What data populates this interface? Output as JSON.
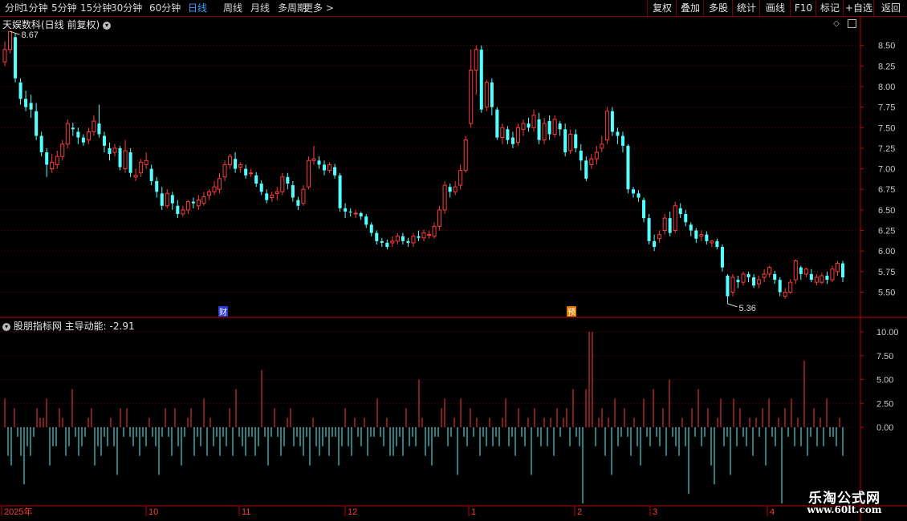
{
  "toolbar": {
    "periods": [
      "分时",
      "1分钟",
      "5分钟",
      "15分钟",
      "30分钟",
      "60分钟",
      "日线",
      "周线",
      "月线",
      "多周期",
      "更多 >"
    ],
    "active_period": "日线",
    "right_buttons": [
      "复权",
      "叠加",
      "多股",
      "统计",
      "画线",
      "F10",
      "标记",
      "+自选",
      "返回"
    ]
  },
  "main_panel": {
    "title": "天娱数科(日线 前复权)",
    "high_label": "8.67",
    "low_label": "5.36",
    "price_ticks": [
      "8.50",
      "8.25",
      "8.00",
      "7.75",
      "7.50",
      "7.25",
      "7.00",
      "6.75",
      "6.50",
      "6.25",
      "6.00",
      "5.75",
      "5.50"
    ],
    "event_badges": [
      {
        "text": "财"
      },
      {
        "text": "预"
      }
    ]
  },
  "indicator_panel": {
    "name": "股朋指标网",
    "line_name": "主导动能:",
    "line_value": "-2.91",
    "ticks": [
      "10.00",
      "7.50",
      "5.00",
      "2.50",
      "0.00"
    ]
  },
  "date_axis": {
    "labels": [
      "2025年",
      "10",
      "11",
      "12",
      "1",
      "2",
      "3",
      "4"
    ]
  },
  "watermark": {
    "title": "乐淘公式网",
    "url": "www.60lt.com"
  },
  "colors": {
    "up": "#ff3b3b",
    "down": "#54ffff",
    "grid": "#7a0000",
    "axis": "#c00000",
    "text": "#c8c8c8"
  },
  "chart_data": {
    "type": "candlestick",
    "title": "天娱数科(日线 前复权)",
    "ylim": [
      5.3,
      8.75
    ],
    "candles": [
      [
        8.3,
        8.45,
        8.25,
        8.55
      ],
      [
        8.45,
        8.67,
        8.4,
        8.67
      ],
      [
        8.6,
        8.1,
        8.05,
        8.65
      ],
      [
        8.05,
        7.85,
        7.78,
        8.1
      ],
      [
        7.85,
        7.75,
        7.7,
        7.95
      ],
      [
        7.8,
        7.72,
        7.62,
        7.9
      ],
      [
        7.7,
        7.4,
        7.35,
        7.8
      ],
      [
        7.4,
        7.2,
        7.15,
        7.45
      ],
      [
        7.2,
        7.05,
        6.9,
        7.25
      ],
      [
        7.0,
        7.08,
        6.95,
        7.18
      ],
      [
        7.05,
        7.15,
        7.0,
        7.22
      ],
      [
        7.15,
        7.3,
        7.1,
        7.35
      ],
      [
        7.3,
        7.55,
        7.25,
        7.6
      ],
      [
        7.5,
        7.48,
        7.4,
        7.56
      ],
      [
        7.45,
        7.38,
        7.3,
        7.5
      ],
      [
        7.38,
        7.32,
        7.28,
        7.42
      ],
      [
        7.35,
        7.45,
        7.3,
        7.5
      ],
      [
        7.45,
        7.58,
        7.4,
        7.65
      ],
      [
        7.55,
        7.42,
        7.38,
        7.78
      ],
      [
        7.4,
        7.28,
        7.2,
        7.45
      ],
      [
        7.25,
        7.18,
        7.1,
        7.32
      ],
      [
        7.2,
        7.25,
        7.15,
        7.3
      ],
      [
        7.25,
        7.02,
        6.98,
        7.28
      ],
      [
        7.0,
        7.22,
        6.95,
        7.35
      ],
      [
        7.2,
        6.95,
        6.9,
        7.25
      ],
      [
        6.9,
        6.92,
        6.85,
        7.0
      ],
      [
        6.95,
        7.08,
        6.9,
        7.12
      ],
      [
        7.05,
        7.1,
        7.0,
        7.2
      ],
      [
        7.0,
        6.85,
        6.8,
        7.05
      ],
      [
        6.85,
        6.72,
        6.65,
        6.9
      ],
      [
        6.7,
        6.55,
        6.5,
        6.78
      ],
      [
        6.55,
        6.7,
        6.52,
        6.75
      ],
      [
        6.68,
        6.58,
        6.5,
        6.72
      ],
      [
        6.55,
        6.45,
        6.4,
        6.62
      ],
      [
        6.45,
        6.5,
        6.42,
        6.55
      ],
      [
        6.5,
        6.6,
        6.45,
        6.62
      ],
      [
        6.6,
        6.58,
        6.52,
        6.65
      ],
      [
        6.55,
        6.62,
        6.5,
        6.68
      ],
      [
        6.58,
        6.66,
        6.55,
        6.72
      ],
      [
        6.68,
        6.72,
        6.62,
        6.75
      ],
      [
        6.72,
        6.78,
        6.68,
        6.85
      ],
      [
        6.75,
        6.88,
        6.7,
        6.95
      ],
      [
        6.9,
        7.05,
        6.85,
        7.1
      ],
      [
        7.05,
        7.15,
        7.0,
        7.18
      ],
      [
        7.12,
        7.0,
        6.95,
        7.2
      ],
      [
        7.02,
        7.05,
        6.95,
        7.08
      ],
      [
        7.0,
        6.92,
        6.88,
        7.05
      ],
      [
        6.95,
        6.95,
        6.9,
        7.0
      ],
      [
        6.92,
        6.82,
        6.78,
        6.96
      ],
      [
        6.82,
        6.72,
        6.68,
        6.86
      ],
      [
        6.7,
        6.62,
        6.58,
        6.75
      ],
      [
        6.65,
        6.68,
        6.6,
        6.72
      ],
      [
        6.7,
        6.72,
        6.62,
        6.78
      ],
      [
        6.72,
        6.9,
        6.68,
        6.95
      ],
      [
        6.9,
        6.82,
        6.75,
        6.95
      ],
      [
        6.8,
        6.65,
        6.6,
        6.85
      ],
      [
        6.62,
        6.55,
        6.5,
        6.66
      ],
      [
        6.58,
        6.75,
        6.55,
        6.8
      ],
      [
        6.78,
        7.1,
        6.75,
        7.15
      ],
      [
        7.1,
        7.12,
        7.05,
        7.28
      ],
      [
        7.1,
        7.05,
        7.0,
        7.15
      ],
      [
        7.05,
        6.98,
        6.92,
        7.1
      ],
      [
        6.98,
        7.05,
        6.95,
        7.08
      ],
      [
        7.02,
        6.92,
        6.88,
        7.06
      ],
      [
        6.92,
        6.52,
        6.48,
        6.95
      ],
      [
        6.52,
        6.48,
        6.4,
        6.58
      ],
      [
        6.48,
        6.47,
        6.42,
        6.52
      ],
      [
        6.46,
        6.46,
        6.4,
        6.5
      ],
      [
        6.46,
        6.42,
        6.38,
        6.48
      ],
      [
        6.42,
        6.32,
        6.28,
        6.45
      ],
      [
        6.32,
        6.22,
        6.18,
        6.35
      ],
      [
        6.22,
        6.12,
        6.08,
        6.25
      ],
      [
        6.12,
        6.1,
        6.05,
        6.16
      ],
      [
        6.1,
        6.05,
        6.02,
        6.14
      ],
      [
        6.1,
        6.12,
        6.05,
        6.18
      ],
      [
        6.12,
        6.18,
        6.08,
        6.22
      ],
      [
        6.18,
        6.12,
        6.08,
        6.22
      ],
      [
        6.12,
        6.1,
        6.05,
        6.16
      ],
      [
        6.1,
        6.18,
        6.05,
        6.22
      ],
      [
        6.18,
        6.16,
        6.12,
        6.25
      ],
      [
        6.16,
        6.22,
        6.12,
        6.26
      ],
      [
        6.2,
        6.2,
        6.15,
        6.25
      ],
      [
        6.18,
        6.3,
        6.15,
        6.35
      ],
      [
        6.3,
        6.5,
        6.25,
        6.55
      ],
      [
        6.5,
        6.8,
        6.45,
        6.85
      ],
      [
        6.78,
        6.72,
        6.65,
        6.82
      ],
      [
        6.72,
        6.78,
        6.68,
        6.85
      ],
      [
        6.8,
        6.98,
        6.75,
        7.05
      ],
      [
        6.98,
        7.35,
        6.95,
        7.4
      ],
      [
        7.55,
        8.2,
        7.5,
        8.45
      ],
      [
        8.2,
        8.45,
        7.9,
        8.5
      ],
      [
        8.45,
        7.72,
        7.68,
        8.5
      ],
      [
        7.75,
        8.05,
        7.7,
        8.08
      ],
      [
        8.05,
        7.75,
        7.65,
        8.1
      ],
      [
        7.72,
        7.38,
        7.35,
        7.75
      ],
      [
        7.38,
        7.5,
        7.3,
        7.55
      ],
      [
        7.48,
        7.35,
        7.3,
        7.52
      ],
      [
        7.38,
        7.3,
        7.25,
        7.45
      ],
      [
        7.32,
        7.5,
        7.28,
        7.55
      ],
      [
        7.48,
        7.55,
        7.4,
        7.6
      ],
      [
        7.55,
        7.5,
        7.45,
        7.62
      ],
      [
        7.5,
        7.65,
        7.45,
        7.72
      ],
      [
        7.6,
        7.35,
        7.3,
        7.68
      ],
      [
        7.35,
        7.55,
        7.3,
        7.62
      ],
      [
        7.58,
        7.42,
        7.35,
        7.65
      ],
      [
        7.42,
        7.6,
        7.38,
        7.65
      ],
      [
        7.55,
        7.48,
        7.4,
        7.58
      ],
      [
        7.48,
        7.2,
        7.15,
        7.55
      ],
      [
        7.22,
        7.42,
        7.18,
        7.48
      ],
      [
        7.42,
        7.25,
        7.2,
        7.48
      ],
      [
        7.22,
        7.1,
        6.98,
        7.3
      ],
      [
        7.1,
        6.88,
        6.85,
        7.15
      ],
      [
        7.05,
        7.12,
        7.0,
        7.18
      ],
      [
        7.12,
        7.2,
        7.05,
        7.28
      ],
      [
        7.25,
        7.3,
        7.2,
        7.4
      ],
      [
        7.35,
        7.7,
        7.3,
        7.75
      ],
      [
        7.7,
        7.45,
        7.4,
        7.75
      ],
      [
        7.45,
        7.4,
        7.3,
        7.5
      ],
      [
        7.4,
        7.28,
        7.2,
        7.45
      ],
      [
        7.28,
        6.75,
        6.7,
        7.3
      ],
      [
        6.75,
        6.7,
        6.65,
        6.78
      ],
      [
        6.7,
        6.65,
        6.6,
        6.74
      ],
      [
        6.62,
        6.4,
        6.35,
        6.65
      ],
      [
        6.4,
        6.12,
        6.08,
        6.45
      ],
      [
        6.12,
        6.05,
        6.0,
        6.2
      ],
      [
        6.15,
        6.2,
        6.1,
        6.25
      ],
      [
        6.25,
        6.4,
        6.2,
        6.45
      ],
      [
        6.4,
        6.22,
        6.18,
        6.48
      ],
      [
        6.25,
        6.55,
        6.22,
        6.6
      ],
      [
        6.52,
        6.45,
        6.4,
        6.58
      ],
      [
        6.45,
        6.35,
        6.3,
        6.5
      ],
      [
        6.32,
        6.25,
        6.18,
        6.35
      ],
      [
        6.25,
        6.15,
        6.1,
        6.28
      ],
      [
        6.18,
        6.2,
        6.12,
        6.25
      ],
      [
        6.2,
        6.12,
        6.08,
        6.24
      ],
      [
        6.1,
        6.12,
        6.05,
        6.14
      ],
      [
        6.12,
        6.05,
        6.02,
        6.15
      ],
      [
        6.05,
        5.8,
        5.75,
        6.08
      ],
      [
        5.7,
        5.45,
        5.36,
        5.72
      ],
      [
        5.5,
        5.68,
        5.45,
        5.72
      ],
      [
        5.65,
        5.62,
        5.55,
        5.7
      ],
      [
        5.62,
        5.72,
        5.58,
        5.75
      ],
      [
        5.72,
        5.68,
        5.62,
        5.75
      ],
      [
        5.68,
        5.58,
        5.55,
        5.72
      ],
      [
        5.6,
        5.65,
        5.55,
        5.7
      ],
      [
        5.68,
        5.72,
        5.62,
        5.78
      ],
      [
        5.72,
        5.8,
        5.68,
        5.82
      ],
      [
        5.72,
        5.65,
        5.6,
        5.76
      ],
      [
        5.65,
        5.5,
        5.45,
        5.68
      ],
      [
        5.45,
        5.5,
        5.42,
        5.55
      ],
      [
        5.5,
        5.62,
        5.48,
        5.66
      ],
      [
        5.65,
        5.88,
        5.6,
        5.9
      ],
      [
        5.8,
        5.72,
        5.65,
        5.82
      ],
      [
        5.72,
        5.78,
        5.68,
        5.8
      ],
      [
        5.72,
        5.65,
        5.62,
        5.78
      ],
      [
        5.62,
        5.68,
        5.58,
        5.72
      ],
      [
        5.62,
        5.7,
        5.6,
        5.74
      ],
      [
        5.7,
        5.65,
        5.6,
        5.75
      ],
      [
        5.65,
        5.78,
        5.62,
        5.82
      ],
      [
        5.75,
        5.85,
        5.7,
        5.88
      ],
      [
        5.85,
        5.68,
        5.62,
        5.88
      ]
    ],
    "momentum": [
      3,
      -3,
      -4,
      2,
      -1,
      -3,
      -6,
      -2,
      -3,
      -1,
      2,
      1,
      1,
      3,
      -4,
      -2,
      -2,
      2,
      1,
      -3,
      -2,
      4,
      -1,
      -3,
      -2,
      -1,
      1,
      2,
      -4,
      -2,
      -3,
      -1,
      -2,
      1,
      -2,
      -5,
      2,
      -1,
      2,
      -1,
      -2,
      -1,
      -3,
      -1,
      -2,
      1,
      -1,
      -2,
      -5,
      -1,
      2,
      -1,
      -3,
      2,
      -2,
      -4,
      -1,
      1,
      2,
      -3,
      -1,
      -2,
      3,
      -3,
      1,
      -2,
      -1,
      -3,
      -1,
      -2,
      2,
      -3,
      4,
      -1,
      -2,
      -3,
      -1,
      -1,
      -3,
      -2,
      6,
      -1,
      -4,
      -1,
      2,
      -1,
      -3,
      -2,
      1,
      2,
      -2,
      -1,
      -2,
      -3,
      -1,
      -4,
      1,
      -2,
      -3,
      -2,
      -1,
      -3,
      -1,
      -1,
      -4,
      -2,
      2,
      -2,
      -3,
      1,
      -1,
      -2,
      1,
      -3,
      -1,
      -1,
      3,
      -1,
      -2,
      1,
      -3,
      -3,
      -2,
      -1,
      -3,
      2,
      -2,
      -1,
      -2,
      5,
      1,
      -3,
      -2,
      -4,
      -1,
      -1,
      2,
      3,
      -2,
      -1,
      1,
      -5,
      3,
      -1,
      -2,
      2,
      -1,
      1,
      -3,
      -1,
      -2,
      1,
      -2,
      -1,
      -2,
      1,
      3,
      -2,
      -1,
      -3,
      2,
      -1,
      -2,
      1,
      -5,
      2,
      -1,
      -2,
      1,
      -2,
      1,
      -3,
      2,
      -1,
      1,
      2,
      -2,
      4,
      -1,
      -2,
      -8,
      4,
      10,
      10,
      -2,
      1,
      2,
      -3,
      1,
      -5,
      3,
      -2,
      -1,
      2,
      -1,
      -3,
      1,
      -2,
      -4,
      3,
      -1,
      -2,
      4,
      -1,
      -2,
      2,
      -3,
      5,
      -1,
      -2,
      -3,
      1,
      -2,
      -7,
      2,
      -1,
      4,
      -2,
      -1,
      2,
      -4,
      -6,
      1,
      3,
      -2,
      -1,
      -5,
      3,
      -2,
      2,
      -1,
      -2,
      1,
      -3,
      1,
      -1,
      2,
      -4,
      3,
      -1,
      -2,
      1,
      -8,
      2,
      -1,
      3,
      -2,
      1,
      -2,
      7,
      -3,
      -1,
      2,
      -2,
      1,
      -2,
      3,
      -1,
      -1,
      -2,
      1,
      -3
    ]
  }
}
